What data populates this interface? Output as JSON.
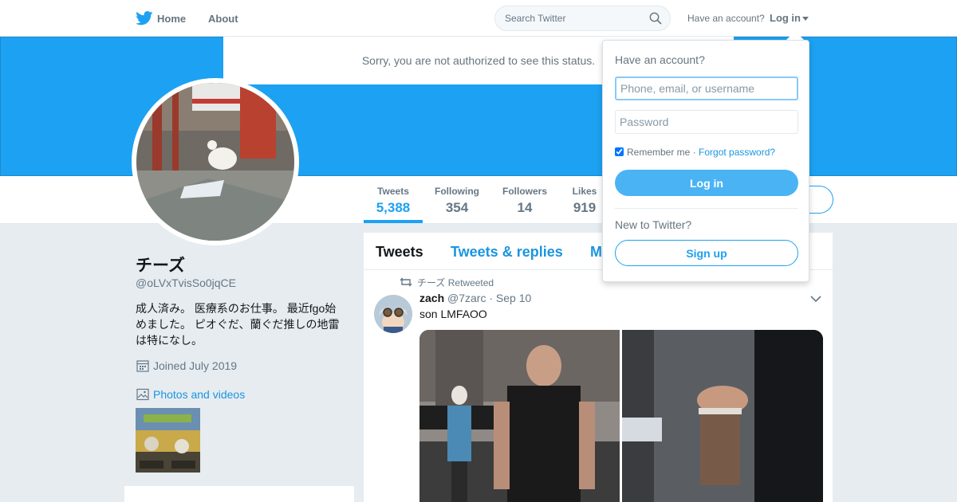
{
  "topbar": {
    "home": "Home",
    "about": "About",
    "search_placeholder": "Search Twitter",
    "have_account": "Have an account?",
    "login": "Log in"
  },
  "notice": "Sorry, you are not authorized to see this status.",
  "stats": [
    {
      "label": "Tweets",
      "value": "5,388"
    },
    {
      "label": "Following",
      "value": "354"
    },
    {
      "label": "Followers",
      "value": "14"
    },
    {
      "label": "Likes",
      "value": "919"
    }
  ],
  "profile": {
    "name": "チーズ",
    "handle": "@oLVxTvisSo0jqCE",
    "bio": "成人済み。 医療系のお仕事。 最近fgo始めました。 ピオぐだ、蘭ぐだ推しの地雷は特になし。",
    "joined": "Joined July 2019",
    "photos_link": "Photos and videos"
  },
  "timeline": {
    "tabs": [
      "Tweets",
      "Tweets & replies",
      "M"
    ],
    "retweet_label": "チーズ Retweeted",
    "tweet": {
      "name": "zach",
      "handle": "@7zarc",
      "sep": " · ",
      "date": "Sep 10",
      "text": "son LMFAOO"
    }
  },
  "login_dropdown": {
    "heading": "Have an account?",
    "username_placeholder": "Phone, email, or username",
    "password_placeholder": "Password",
    "remember": "Remember me",
    "sep": " · ",
    "forgot": "Forgot password?",
    "login_button": "Log in",
    "new_heading": "New to Twitter?",
    "signup_button": "Sign up"
  },
  "colors": {
    "brand": "#1da1f2",
    "link": "#1b95e0"
  }
}
